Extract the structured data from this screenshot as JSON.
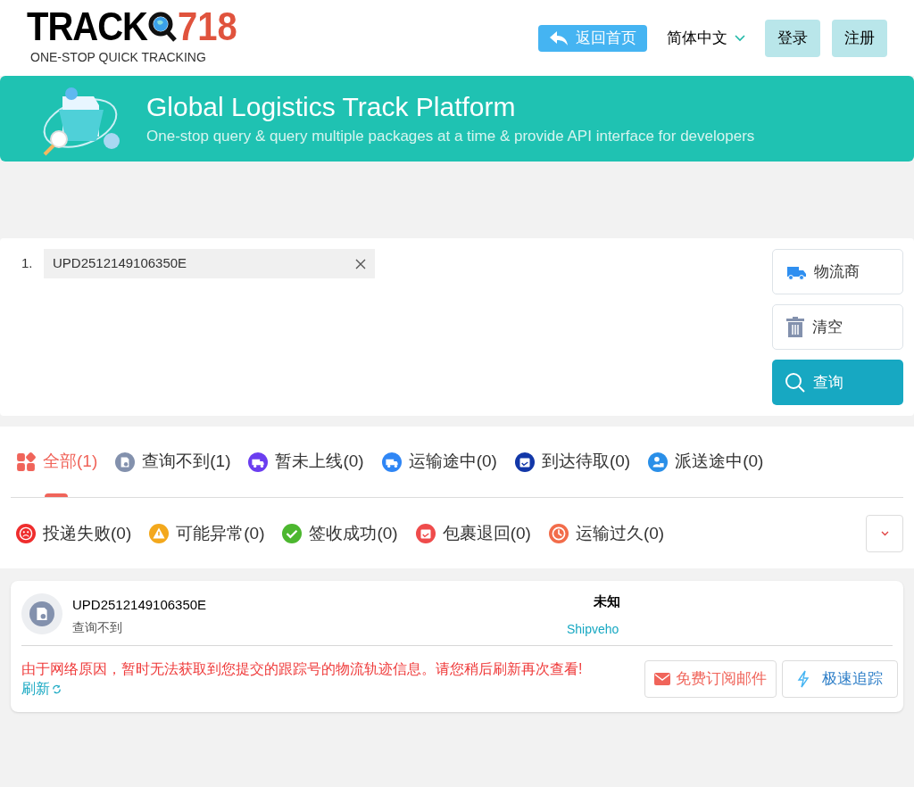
{
  "logo": {
    "brand": "TRACK",
    "number": "718",
    "tagline": "ONE-STOP QUICK TRACKING"
  },
  "nav": {
    "home": "返回首页",
    "language": "简体中文",
    "login": "登录",
    "register": "注册"
  },
  "banner": {
    "title": "Global Logistics Track Platform",
    "subtitle": "One-stop query & query multiple packages at a time & provide API interface for developers"
  },
  "numbers": [
    {
      "index": "1.",
      "value": "UPD2512149106350E"
    }
  ],
  "actions": [
    {
      "kind": "carrier",
      "label": "物流商"
    },
    {
      "kind": "clear",
      "label": "清空"
    },
    {
      "kind": "query",
      "label": "查询"
    }
  ],
  "status_tabs": [
    [
      {
        "label": "全部(1)",
        "kind": "all",
        "color": "#f0645a",
        "selected": true
      },
      {
        "label": "查询不到(1)",
        "kind": "notfound",
        "color": "#8391ad",
        "selected": false
      },
      {
        "label": "暂未上线(0)",
        "kind": "truck",
        "color": "#6b3ef0",
        "selected": false
      },
      {
        "label": "运输途中(0)",
        "kind": "truck",
        "color": "#2f86f5",
        "selected": false
      },
      {
        "label": "到达待取(0)",
        "kind": "calendar",
        "color": "#1237a8",
        "selected": false
      },
      {
        "label": "派送途中(0)",
        "kind": "person",
        "color": "#2a8fe8",
        "selected": false
      }
    ],
    [
      {
        "label": "投递失败(0)",
        "kind": "sad",
        "color": "#ef2d2d",
        "selected": false
      },
      {
        "label": "可能异常(0)",
        "kind": "warn",
        "color": "#f3a81c",
        "selected": false
      },
      {
        "label": "签收成功(0)",
        "kind": "check",
        "color": "#4cb72f",
        "selected": false
      },
      {
        "label": "包裹退回(0)",
        "kind": "calendar",
        "color": "#ef4b4b",
        "selected": false
      },
      {
        "label": "运输过久(0)",
        "kind": "clock",
        "color": "#f26c4a",
        "selected": false
      }
    ]
  ],
  "results": [
    {
      "number": "UPD2512149106350E",
      "status": "查询不到",
      "destination": "未知",
      "carrier": "Shipveho",
      "message": "由于网络原因，暂时无法获取到您提交的跟踪号的物流轨迹信息。请您稍后刷新再次查看!",
      "refresh": "刷新",
      "subscribe": "免费订阅邮件",
      "fast_track": "极速追踪"
    }
  ]
}
